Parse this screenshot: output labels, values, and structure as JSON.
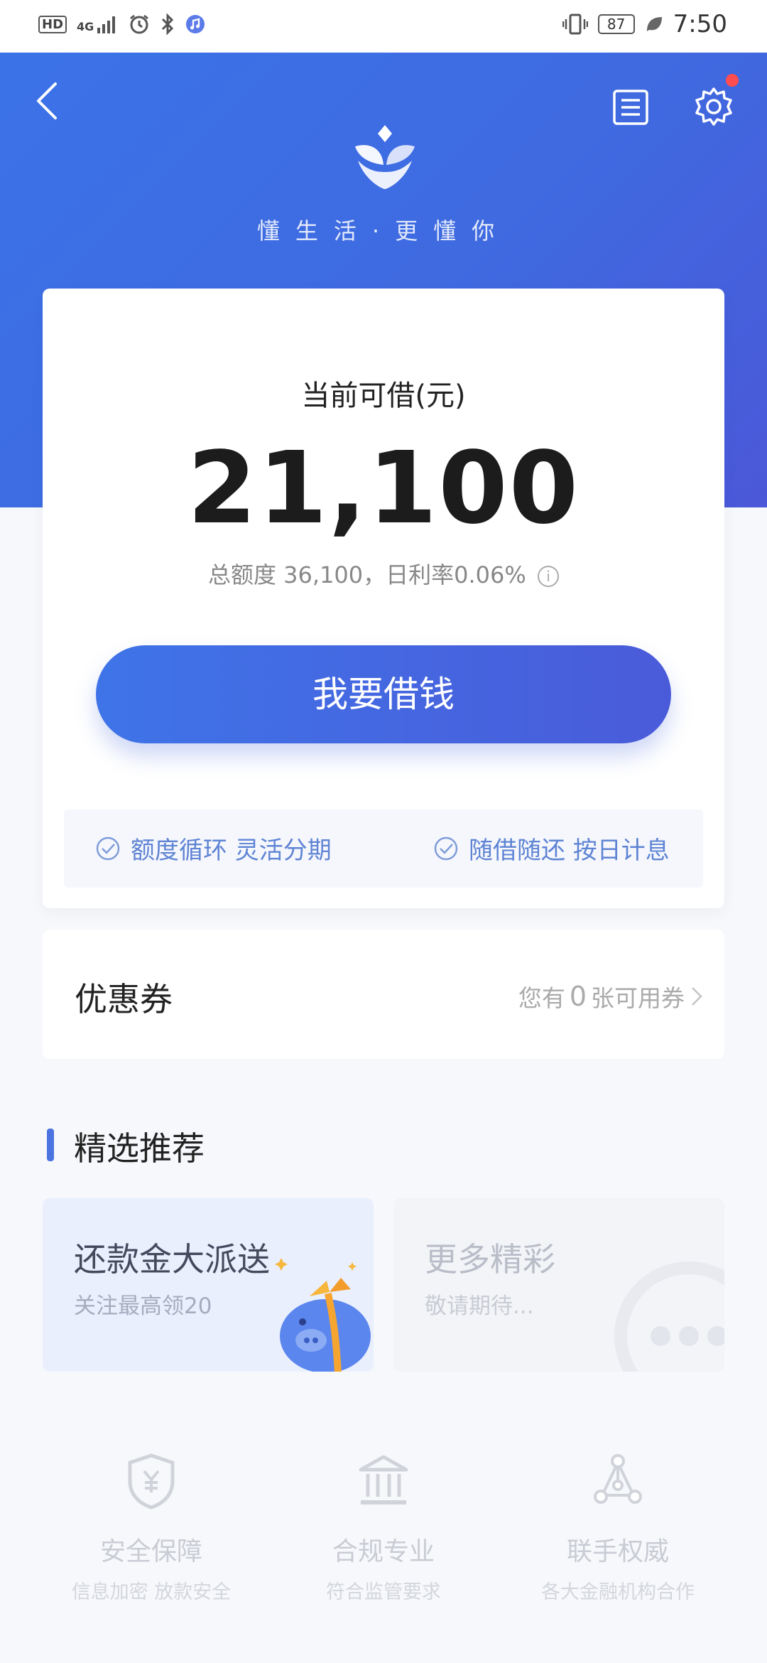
{
  "status_bar": {
    "left_icons": [
      "hd-icon",
      "signal-4g-icon",
      "alarm-icon",
      "bluetooth-icon",
      "music-icon"
    ],
    "hd_label": "HD",
    "network_label": "4G",
    "battery": "87",
    "time": "7:50"
  },
  "header": {
    "slogan": "懂生活·更懂你"
  },
  "loan_card": {
    "label": "当前可借(元)",
    "amount": "21,100",
    "summary": "总额度 36,100，日利率0.06%",
    "info_icon": "i",
    "borrow_button": "我要借钱",
    "features": [
      "额度循环 灵活分期",
      "随借随还 按日计息"
    ]
  },
  "coupon": {
    "title": "优惠券",
    "prefix": "您有",
    "count": "0",
    "suffix": "张可用券"
  },
  "recommend": {
    "section_title": "精选推荐",
    "tiles": [
      {
        "title": "还款金大派送",
        "subtitle": "关注最高领20"
      },
      {
        "title": "更多精彩",
        "subtitle": "敬请期待..."
      }
    ]
  },
  "trust": [
    {
      "icon": "shield-yuan-icon",
      "title": "安全保障",
      "subtitle": "信息加密 放款安全"
    },
    {
      "icon": "bank-icon",
      "title": "合规专业",
      "subtitle": "符合监管要求"
    },
    {
      "icon": "network-icon",
      "title": "联手权威",
      "subtitle": "各大金融机构合作"
    }
  ],
  "colors": {
    "brand_blue": "#3f6ae0",
    "feature_text": "#5f84d4",
    "notification_dot": "#ff4d4f"
  }
}
